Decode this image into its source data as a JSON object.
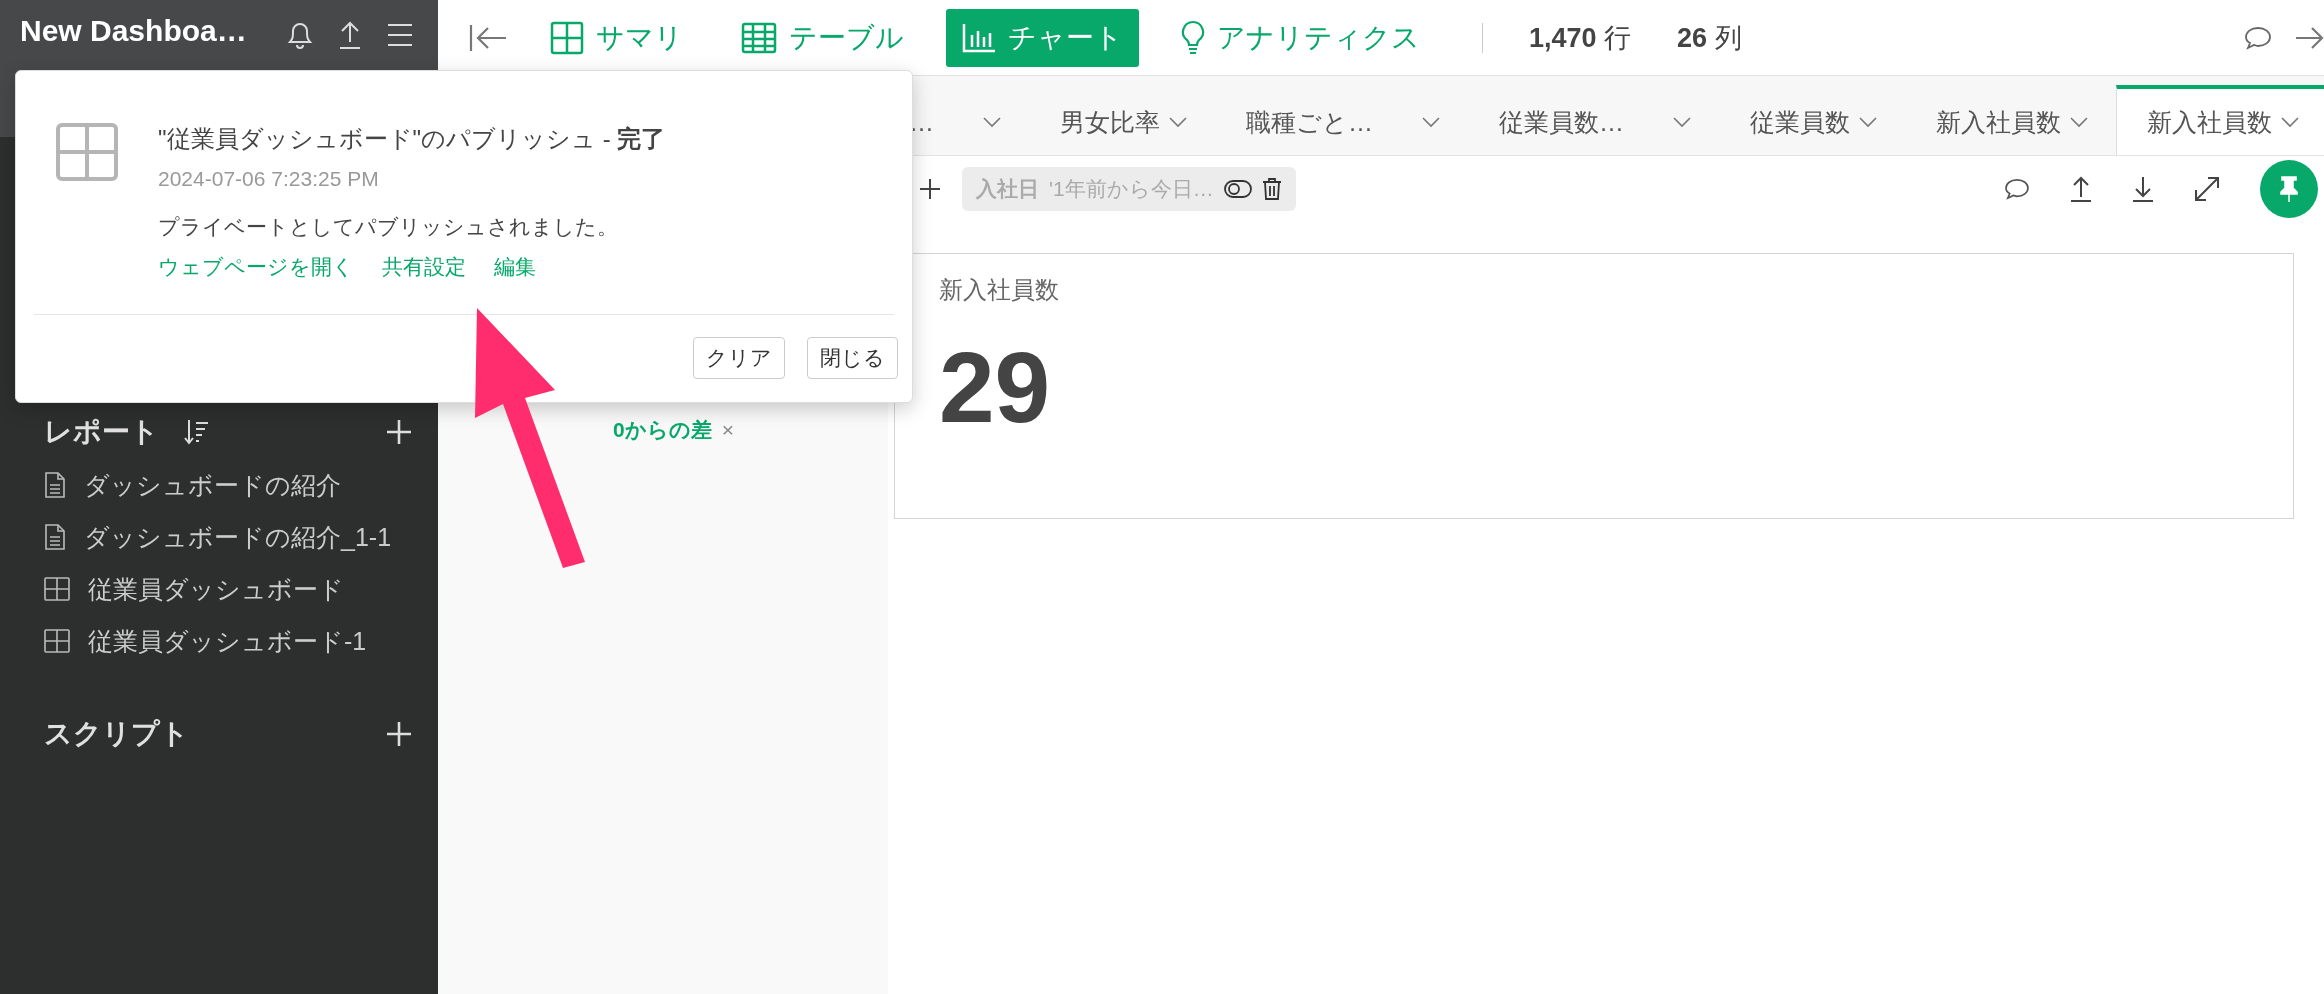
{
  "sidebar": {
    "title": "New Dashboa…",
    "sections": [
      {
        "kind": "reports",
        "title": "レポート",
        "items": [
          {
            "kind": "document",
            "label": "ダッシュボードの紹介"
          },
          {
            "kind": "document",
            "label": "ダッシュボードの紹介_1-1"
          },
          {
            "kind": "dashboard",
            "label": "従業員ダッシュボード"
          },
          {
            "kind": "dashboard",
            "label": "従業員ダッシュボード-1"
          }
        ]
      },
      {
        "kind": "scripts",
        "title": "スクリプト"
      }
    ]
  },
  "toolbar": {
    "nav": [
      {
        "kind": "summary",
        "label": "サマリ",
        "selected": false
      },
      {
        "kind": "table",
        "label": "テーブル",
        "selected": false
      },
      {
        "kind": "chart",
        "label": "チャート",
        "selected": true
      },
      {
        "kind": "analytics",
        "label": "アナリティクス",
        "selected": false
      }
    ],
    "rows": {
      "count": "1,470",
      "unit": "行"
    },
    "columns": {
      "count": "26",
      "unit": "列"
    }
  },
  "tabs": [
    {
      "label": "…",
      "selected": false
    },
    {
      "label": "男女比率",
      "selected": false
    },
    {
      "label": "職種ごと…",
      "selected": false
    },
    {
      "label": "従業員数…",
      "selected": false
    },
    {
      "label": "従業員数",
      "selected": false
    },
    {
      "label": "新入社員数",
      "selected": false
    },
    {
      "label": "新入社員数",
      "selected": true
    }
  ],
  "filter": {
    "field": "入社日",
    "value": "'1年前から今日…"
  },
  "legend_note": {
    "value": "0からの差",
    "close": "×"
  },
  "card": {
    "title": "新入社員数",
    "value": "29"
  },
  "notification": {
    "title": "\"従業員ダッシュボード\"のパブリッシュ - **完了**",
    "timestamp": "2024-07-06 7:23:25 PM",
    "message": "プライベートとしてパブリッシュされました。",
    "links": [
      "ウェブページを開く",
      "共有設定",
      "編集"
    ],
    "buttons": [
      "クリア",
      "閉じる"
    ]
  }
}
